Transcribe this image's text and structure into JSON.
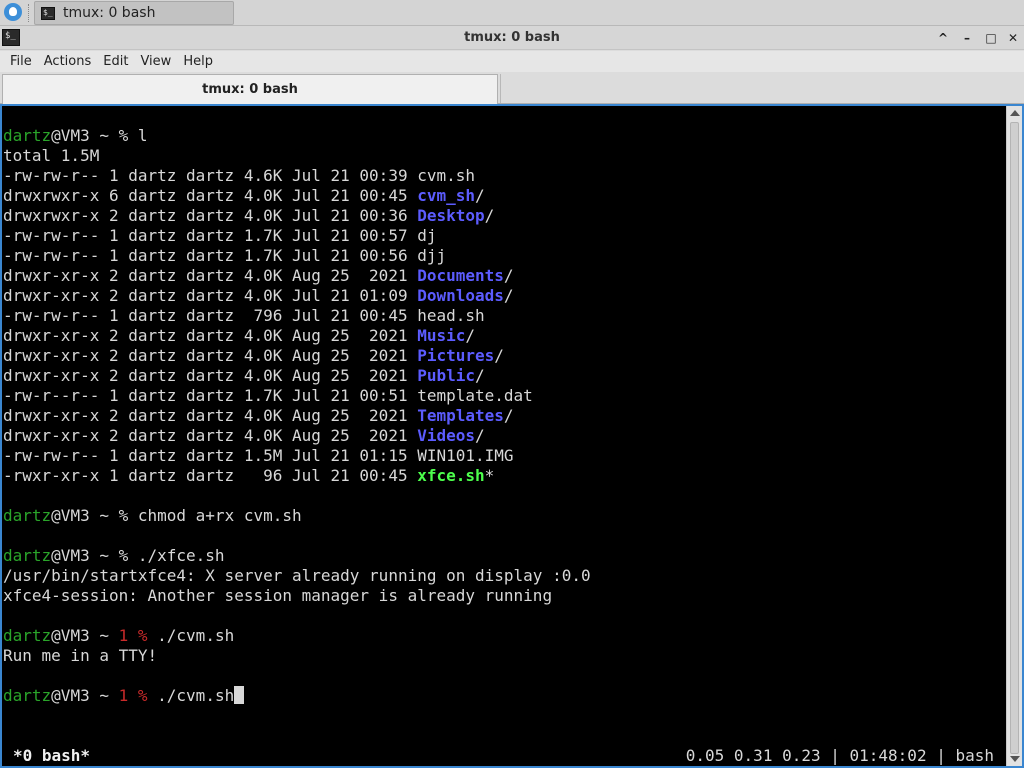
{
  "taskbar": {
    "task_label": "tmux: 0 bash"
  },
  "window": {
    "title": "tmux: 0 bash",
    "controls": {
      "minimize": "^",
      "maximize": "–",
      "restore": "□",
      "close": "✕"
    }
  },
  "menu": [
    "File",
    "Actions",
    "Edit",
    "View",
    "Help"
  ],
  "tabs": [
    {
      "label": "tmux: 0 bash",
      "active": true
    }
  ],
  "terminal": {
    "colors": {
      "background": "#000000",
      "foreground": "#d8d8d8",
      "prompt_user": "#2aa52a",
      "exit_code": "#c82a2a",
      "directory": "#5c5cff",
      "executable": "#4cff4c"
    },
    "lines": [
      [
        {
          "t": "dartz",
          "c": "g"
        },
        {
          "t": "@VM3 ~ % l"
        }
      ],
      [
        {
          "t": "total 1.5M"
        }
      ],
      [
        {
          "t": "-rw-rw-r-- 1 dartz dartz 4.6K Jul 21 00:39 cvm.sh"
        }
      ],
      [
        {
          "t": "drwxrwxr-x 6 dartz dartz 4.0K Jul 21 00:45 "
        },
        {
          "t": "cvm_sh",
          "c": "b"
        },
        {
          "t": "/"
        }
      ],
      [
        {
          "t": "drwxrwxr-x 2 dartz dartz 4.0K Jul 21 00:36 "
        },
        {
          "t": "Desktop",
          "c": "b"
        },
        {
          "t": "/"
        }
      ],
      [
        {
          "t": "-rw-rw-r-- 1 dartz dartz 1.7K Jul 21 00:57 dj"
        }
      ],
      [
        {
          "t": "-rw-rw-r-- 1 dartz dartz 1.7K Jul 21 00:56 djj"
        }
      ],
      [
        {
          "t": "drwxr-xr-x 2 dartz dartz 4.0K Aug 25  2021 "
        },
        {
          "t": "Documents",
          "c": "b"
        },
        {
          "t": "/"
        }
      ],
      [
        {
          "t": "drwxr-xr-x 2 dartz dartz 4.0K Jul 21 01:09 "
        },
        {
          "t": "Downloads",
          "c": "b"
        },
        {
          "t": "/"
        }
      ],
      [
        {
          "t": "-rw-rw-r-- 1 dartz dartz  796 Jul 21 00:45 head.sh"
        }
      ],
      [
        {
          "t": "drwxr-xr-x 2 dartz dartz 4.0K Aug 25  2021 "
        },
        {
          "t": "Music",
          "c": "b"
        },
        {
          "t": "/"
        }
      ],
      [
        {
          "t": "drwxr-xr-x 2 dartz dartz 4.0K Aug 25  2021 "
        },
        {
          "t": "Pictures",
          "c": "b"
        },
        {
          "t": "/"
        }
      ],
      [
        {
          "t": "drwxr-xr-x 2 dartz dartz 4.0K Aug 25  2021 "
        },
        {
          "t": "Public",
          "c": "b"
        },
        {
          "t": "/"
        }
      ],
      [
        {
          "t": "-rw-r--r-- 1 dartz dartz 1.7K Jul 21 00:51 template.dat"
        }
      ],
      [
        {
          "t": "drwxr-xr-x 2 dartz dartz 4.0K Aug 25  2021 "
        },
        {
          "t": "Templates",
          "c": "b"
        },
        {
          "t": "/"
        }
      ],
      [
        {
          "t": "drwxr-xr-x 2 dartz dartz 4.0K Aug 25  2021 "
        },
        {
          "t": "Videos",
          "c": "b"
        },
        {
          "t": "/"
        }
      ],
      [
        {
          "t": "-rw-rw-r-- 1 dartz dartz 1.5M Jul 21 01:15 WIN101.IMG"
        }
      ],
      [
        {
          "t": "-rwxr-xr-x 1 dartz dartz   96 Jul 21 00:45 "
        },
        {
          "t": "xfce.sh",
          "c": "bg"
        },
        {
          "t": "*"
        }
      ],
      [],
      [
        {
          "t": "dartz",
          "c": "g"
        },
        {
          "t": "@VM3 ~ % chmod a+rx cvm.sh"
        }
      ],
      [],
      [
        {
          "t": "dartz",
          "c": "g"
        },
        {
          "t": "@VM3 ~ % ./xfce.sh"
        }
      ],
      [
        {
          "t": "/usr/bin/startxfce4: X server already running on display :0.0"
        }
      ],
      [
        {
          "t": "xfce4-session: Another session manager is already running"
        }
      ],
      [],
      [
        {
          "t": "dartz",
          "c": "g"
        },
        {
          "t": "@VM3 ~ "
        },
        {
          "t": "1 %",
          "c": "r"
        },
        {
          "t": " ./cvm.sh"
        }
      ],
      [
        {
          "t": "Run me in a TTY!"
        }
      ],
      [],
      [
        {
          "t": "dartz",
          "c": "g"
        },
        {
          "t": "@VM3 ~ "
        },
        {
          "t": "1 %",
          "c": "r"
        },
        {
          "t": " ./cvm.sh"
        },
        {
          "cursor": true
        }
      ]
    ],
    "status_left": "*0 bash*",
    "status_right": "0.05 0.31 0.23 | 01:48:02 | bash"
  }
}
